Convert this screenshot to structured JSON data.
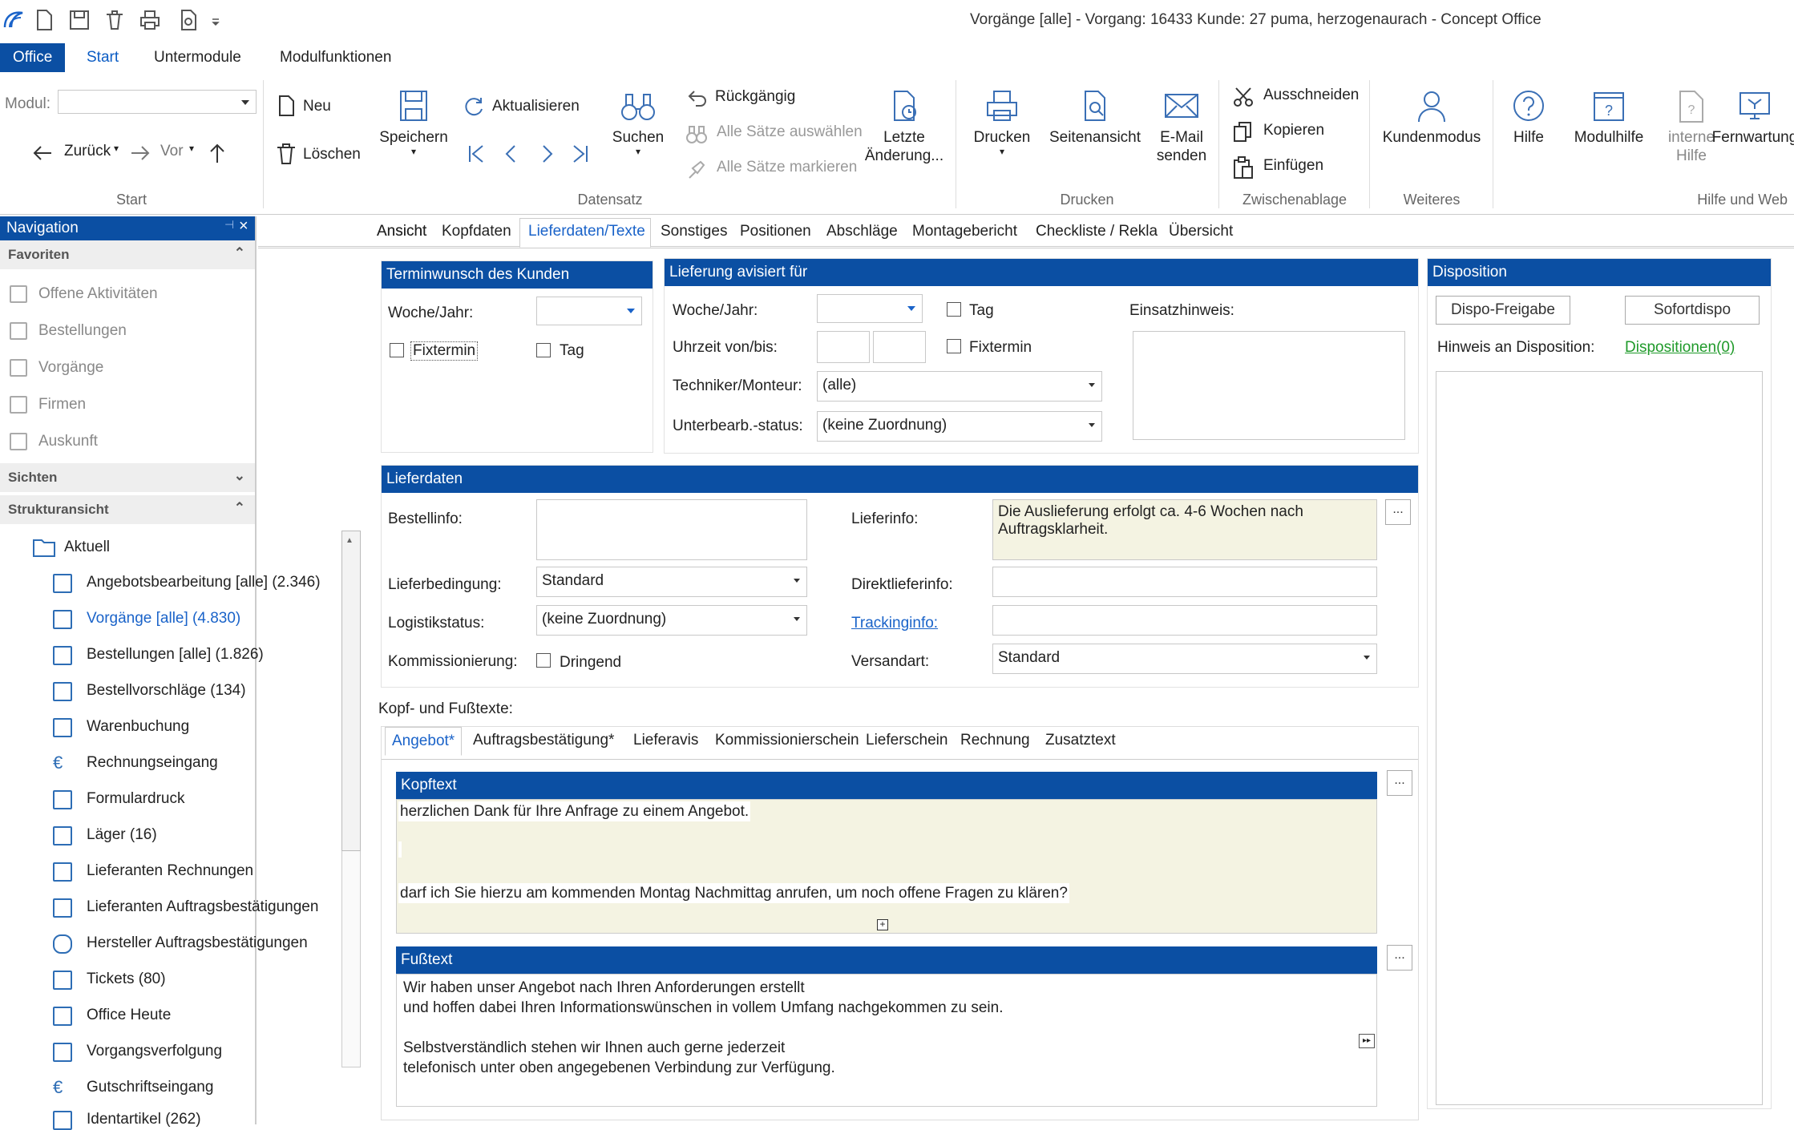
{
  "window": {
    "title": "Vorgänge [alle] - Vorgang: 16433 Kunde: 27 puma, herzogenaurach - Concept Office"
  },
  "ribbon_tabs": [
    {
      "label": "Office"
    },
    {
      "label": "Start"
    },
    {
      "label": "Untermodule"
    },
    {
      "label": "Modulfunktionen"
    }
  ],
  "start_group": {
    "modul_label": "Modul:",
    "modul_value": "",
    "back": "Zurück",
    "forward": "Vor",
    "label": "Start"
  },
  "datensatz": {
    "neu": "Neu",
    "loeschen": "Löschen",
    "speichern": "Speichern",
    "aktualisieren": "Aktualisieren",
    "suchen": "Suchen",
    "rueckgaengig": "Rückgängig",
    "alle_auswaehlen": "Alle Sätze auswählen",
    "alle_markieren": "Alle Sätze markieren",
    "letzte_1": "Letzte",
    "letzte_2": "Änderung...",
    "label": "Datensatz"
  },
  "drucken": {
    "drucken": "Drucken",
    "seitenansicht": "Seitenansicht",
    "email_1": "E-Mail",
    "email_2": "senden",
    "label": "Drucken"
  },
  "zwischenablage": {
    "ausschneiden": "Ausschneiden",
    "kopieren": "Kopieren",
    "einfuegen": "Einfügen",
    "label": "Zwischenablage"
  },
  "weiteres": {
    "kundenmodus": "Kundenmodus",
    "label": "Weiteres"
  },
  "hilfe": {
    "hilfe": "Hilfe",
    "modulhilfe": "Modulhilfe",
    "interne_1": "interne",
    "interne_2": "Hilfe",
    "fernwartung": "Fernwartung",
    "label": "Hilfe und Web"
  },
  "navigation": {
    "title": "Navigation",
    "favoriten": "Favoriten",
    "favorites": [
      {
        "label": "Offene Aktivitäten"
      },
      {
        "label": "Bestellungen"
      },
      {
        "label": "Vorgänge"
      },
      {
        "label": "Firmen"
      },
      {
        "label": "Auskunft"
      }
    ],
    "sichten": "Sichten",
    "struktur": "Strukturansicht",
    "root": "Aktuell",
    "tree": [
      {
        "label": "Angebotsbearbeitung [alle] (2.346)"
      },
      {
        "label": "Vorgänge [alle] (4.830)"
      },
      {
        "label": "Bestellungen [alle] (1.826)"
      },
      {
        "label": "Bestellvorschläge (134)"
      },
      {
        "label": "Warenbuchung"
      },
      {
        "label": "Rechnungseingang"
      },
      {
        "label": "Formulardruck"
      },
      {
        "label": "Läger (16)"
      },
      {
        "label": "Lieferanten Rechnungen"
      },
      {
        "label": "Lieferanten Auftragsbestätigungen"
      },
      {
        "label": "Hersteller Auftragsbestätigungen"
      },
      {
        "label": "Tickets (80)"
      },
      {
        "label": "Office Heute"
      },
      {
        "label": "Vorgangsverfolgung"
      },
      {
        "label": "Gutschriftseingang"
      },
      {
        "label": "Identartikel (262)"
      }
    ]
  },
  "content_tabs": [
    {
      "label": "Ansicht"
    },
    {
      "label": "Kopfdaten"
    },
    {
      "label": "Lieferdaten/Texte"
    },
    {
      "label": "Sonstiges"
    },
    {
      "label": "Positionen"
    },
    {
      "label": "Abschläge"
    },
    {
      "label": "Montagebericht"
    },
    {
      "label": "Checkliste / Rekla"
    },
    {
      "label": "Übersicht"
    }
  ],
  "terminwunsch": {
    "title": "Terminwunsch des Kunden",
    "woche_label": "Woche/Jahr:",
    "woche_value": "",
    "fixtermin": "Fixtermin",
    "tag": "Tag"
  },
  "lieferung": {
    "title": "Lieferung avisiert für",
    "woche_label": "Woche/Jahr:",
    "woche_value": "",
    "tag": "Tag",
    "uhrzeit_label": "Uhrzeit von/bis:",
    "uhrzeit_von": "",
    "uhrzeit_bis": "",
    "fixtermin": "Fixtermin",
    "techniker_label": "Techniker/Monteur:",
    "techniker_value": "(alle)",
    "status_label": "Unterbearb.-status:",
    "status_value": "(keine Zuordnung)",
    "einsatz_label": "Einsatzhinweis:",
    "einsatz_value": ""
  },
  "disposition": {
    "title": "Disposition",
    "freigabe": "Dispo-Freigabe",
    "sofort": "Sofortdispo",
    "hinweis_label": "Hinweis an Disposition:",
    "dispositionen": "Dispositionen(0)"
  },
  "lieferdaten": {
    "title": "Lieferdaten",
    "bestellinfo_label": "Bestellinfo:",
    "bestellinfo_value": "",
    "lieferinfo_label": "Lieferinfo:",
    "lieferinfo_line1": "Die Auslieferung erfolgt ca. 4-6 Wochen nach",
    "lieferinfo_line2": "Auftragsklarheit.",
    "lieferbedingung_label": "Lieferbedingung:",
    "lieferbedingung_value": "Standard",
    "direkt_label": "Direktlieferinfo:",
    "direkt_value": "",
    "logistik_label": "Logistikstatus:",
    "logistik_value": "(keine Zuordnung)",
    "tracking_label": "Trackinginfo:",
    "tracking_value": "",
    "kommission_label": "Kommissionierung:",
    "dringend": "Dringend",
    "versand_label": "Versandart:",
    "versand_value": "Standard"
  },
  "texte": {
    "label": "Kopf- und Fußtexte:",
    "tabs": [
      {
        "label": "Angebot*"
      },
      {
        "label": "Auftragsbestätigung*"
      },
      {
        "label": "Lieferavis"
      },
      {
        "label": "Kommissionierschein"
      },
      {
        "label": "Lieferschein"
      },
      {
        "label": "Rechnung"
      },
      {
        "label": "Zusatztext"
      }
    ],
    "kopf_title": "Kopftext",
    "kopf_line1": "herzlichen Dank für Ihre Anfrage zu einem Angebot.",
    "kopf_line2": "darf ich Sie hierzu am kommenden Montag Nachmittag anrufen, um noch offene Fragen zu klären?",
    "fuss_title": "Fußtext",
    "fuss_line1": "Wir haben unser Angebot nach Ihren Anforderungen erstellt",
    "fuss_line2": "und hoffen dabei Ihren Informationswünschen in vollem Umfang nachgekommen zu sein.",
    "fuss_line3": "Selbstverständlich stehen wir Ihnen auch gerne jederzeit",
    "fuss_line4": "telefonisch unter oben angegebenen Verbindung zur Verfügung.",
    "ellipsis": "..."
  }
}
